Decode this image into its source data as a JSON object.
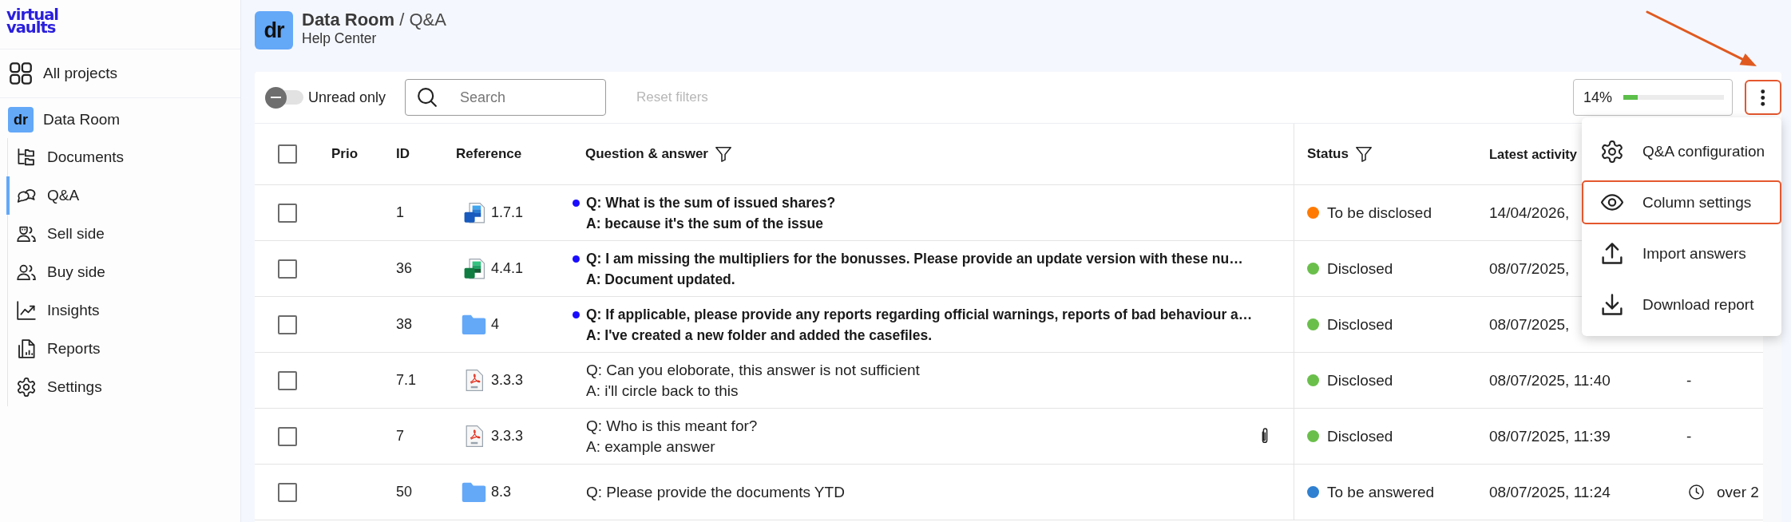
{
  "sidebar": {
    "logo": "virtual vaults",
    "all_projects": {
      "label": "All projects"
    },
    "project": {
      "avatar": "dr",
      "name": "Data Room"
    },
    "items": [
      {
        "label": "Documents",
        "selected": false
      },
      {
        "label": "Q&A",
        "selected": true
      },
      {
        "label": "Sell side",
        "selected": false
      },
      {
        "label": "Buy side",
        "selected": false
      },
      {
        "label": "Insights",
        "selected": false
      },
      {
        "label": "Reports",
        "selected": false
      },
      {
        "label": "Settings",
        "selected": false
      }
    ]
  },
  "header": {
    "avatar": "dr",
    "title": "**Data Room** / Q&A",
    "subtitle": "Help Center"
  },
  "toolbar": {
    "unread_toggle": {
      "label": "Unread only",
      "on": false
    },
    "search": {
      "placeholder": "Search"
    },
    "reset_filters": {
      "label": "Reset filters",
      "disabled": true
    },
    "progress": {
      "reading": "14%",
      "level": 0.14
    },
    "more_button": {
      "highlighted": true
    }
  },
  "table": {
    "select_all": {
      "checked": false
    },
    "columns": [
      {
        "label": "Prio",
        "filter": false
      },
      {
        "label": "ID",
        "filter": false
      },
      {
        "label": "Reference",
        "filter": false
      },
      {
        "label": "Question & answer",
        "filter": true
      },
      {
        "label": "Status",
        "filter": true
      },
      {
        "label": "Latest activity",
        "filter": false
      }
    ],
    "rows": [
      {
        "selected": false,
        "id": "1",
        "reference": {
          "kind": "word",
          "label": "1.7.1"
        },
        "unread": true,
        "question": "Q: What is the sum of issued shares?",
        "answer": "A: because it's the sum of the issue",
        "attachment": false,
        "status": {
          "label": "To be disclosed",
          "color": "#ff7a00"
        },
        "latest_activity": "14/04/2026,"
      },
      {
        "selected": false,
        "id": "36",
        "reference": {
          "kind": "excel",
          "label": "4.4.1"
        },
        "unread": true,
        "question": "Q: I am missing the multipliers for the bonusses. Please provide an update version with these nu…",
        "answer": "A: Document updated.",
        "attachment": false,
        "status": {
          "label": "Disclosed",
          "color": "#6abf4b"
        },
        "latest_activity": "08/07/2025,"
      },
      {
        "selected": false,
        "id": "38",
        "reference": {
          "kind": "folder",
          "label": "4"
        },
        "unread": true,
        "question": "Q: If applicable, please provide any reports regarding official warnings, reports of bad behaviour a…",
        "answer": "A: I've created a new folder and added the casefiles.",
        "attachment": false,
        "status": {
          "label": "Disclosed",
          "color": "#6abf4b"
        },
        "latest_activity": "08/07/2025,"
      },
      {
        "selected": false,
        "id": "7.1",
        "reference": {
          "kind": "pdf",
          "label": "3.3.3"
        },
        "unread": false,
        "question": "Q: Can you eloborate, this answer is not sufficient",
        "answer": "A: i'll circle back to this",
        "attachment": false,
        "status": {
          "label": "Disclosed",
          "color": "#6abf4b"
        },
        "latest_activity": "08/07/2025, 11:40",
        "column_7": {
          "text": "-",
          "clock": false
        }
      },
      {
        "selected": false,
        "id": "7",
        "reference": {
          "kind": "pdf",
          "label": "3.3.3"
        },
        "unread": false,
        "question": "Q: Who is this meant for?",
        "answer": "A: example answer",
        "attachment": true,
        "status": {
          "label": "Disclosed",
          "color": "#6abf4b"
        },
        "latest_activity": "08/07/2025, 11:39",
        "column_7": {
          "text": "-",
          "clock": false
        }
      },
      {
        "selected": false,
        "id": "50",
        "reference": {
          "kind": "folder",
          "label": "8.3"
        },
        "unread": false,
        "question": "Q: Please provide the documents YTD",
        "attachment": false,
        "status": {
          "label": "To be answered",
          "color": "#2f80d0"
        },
        "latest_activity": "08/07/2025, 11:24",
        "column_7": {
          "text": "over 2",
          "clock": true
        }
      }
    ]
  },
  "menu": {
    "items": [
      {
        "label": "Q&A configuration",
        "highlighted": false
      },
      {
        "label": "Column settings",
        "highlighted": true
      },
      {
        "label": "Import answers",
        "highlighted": false
      },
      {
        "label": "Download report",
        "highlighted": false
      }
    ]
  }
}
